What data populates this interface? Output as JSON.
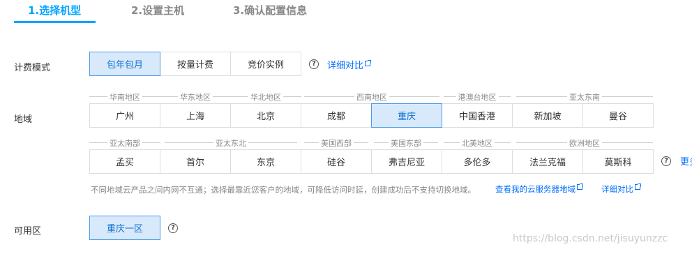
{
  "steps": [
    {
      "label": "1.选择机型",
      "active": true
    },
    {
      "label": "2.设置主机",
      "active": false
    },
    {
      "label": "3.确认配置信息",
      "active": false
    }
  ],
  "billing": {
    "label": "计费模式",
    "options": [
      "包年包月",
      "按量计费",
      "竞价实例"
    ],
    "selected": "包年包月",
    "compare_link": "详细对比"
  },
  "region": {
    "label": "地域",
    "row1_groups": [
      "华南地区",
      "华东地区",
      "华北地区",
      "西南地区",
      "港澳台地区",
      "亚太东南"
    ],
    "row1": [
      "广州",
      "上海",
      "北京",
      "成都",
      "重庆",
      "中国香港",
      "新加坡",
      "曼谷"
    ],
    "row2_groups": [
      "亚太南部",
      "亚太东北",
      "美国西部",
      "美国东部",
      "北美地区",
      "欧洲地区"
    ],
    "row2": [
      "孟买",
      "首尔",
      "东京",
      "硅谷",
      "弗吉尼亚",
      "多伦多",
      "法兰克福",
      "莫斯科"
    ],
    "selected": "重庆",
    "more_link": "更多",
    "note": "不同地域云产品之间内网不互通；选择最靠近您客户的地域，可降低访问时延，创建成功后不支持切换地域。",
    "my_servers_link": "查看我的云服务器地域",
    "compare_link": "详细对比"
  },
  "zone": {
    "label": "可用区",
    "options": [
      "重庆一区"
    ],
    "selected": "重庆一区"
  },
  "watermark": "https://blog.csdn.net/jisuyunzzc",
  "colors": {
    "accent": "#00a4ff",
    "selected_bg": "#d8e9fb",
    "link": "#006eff"
  }
}
